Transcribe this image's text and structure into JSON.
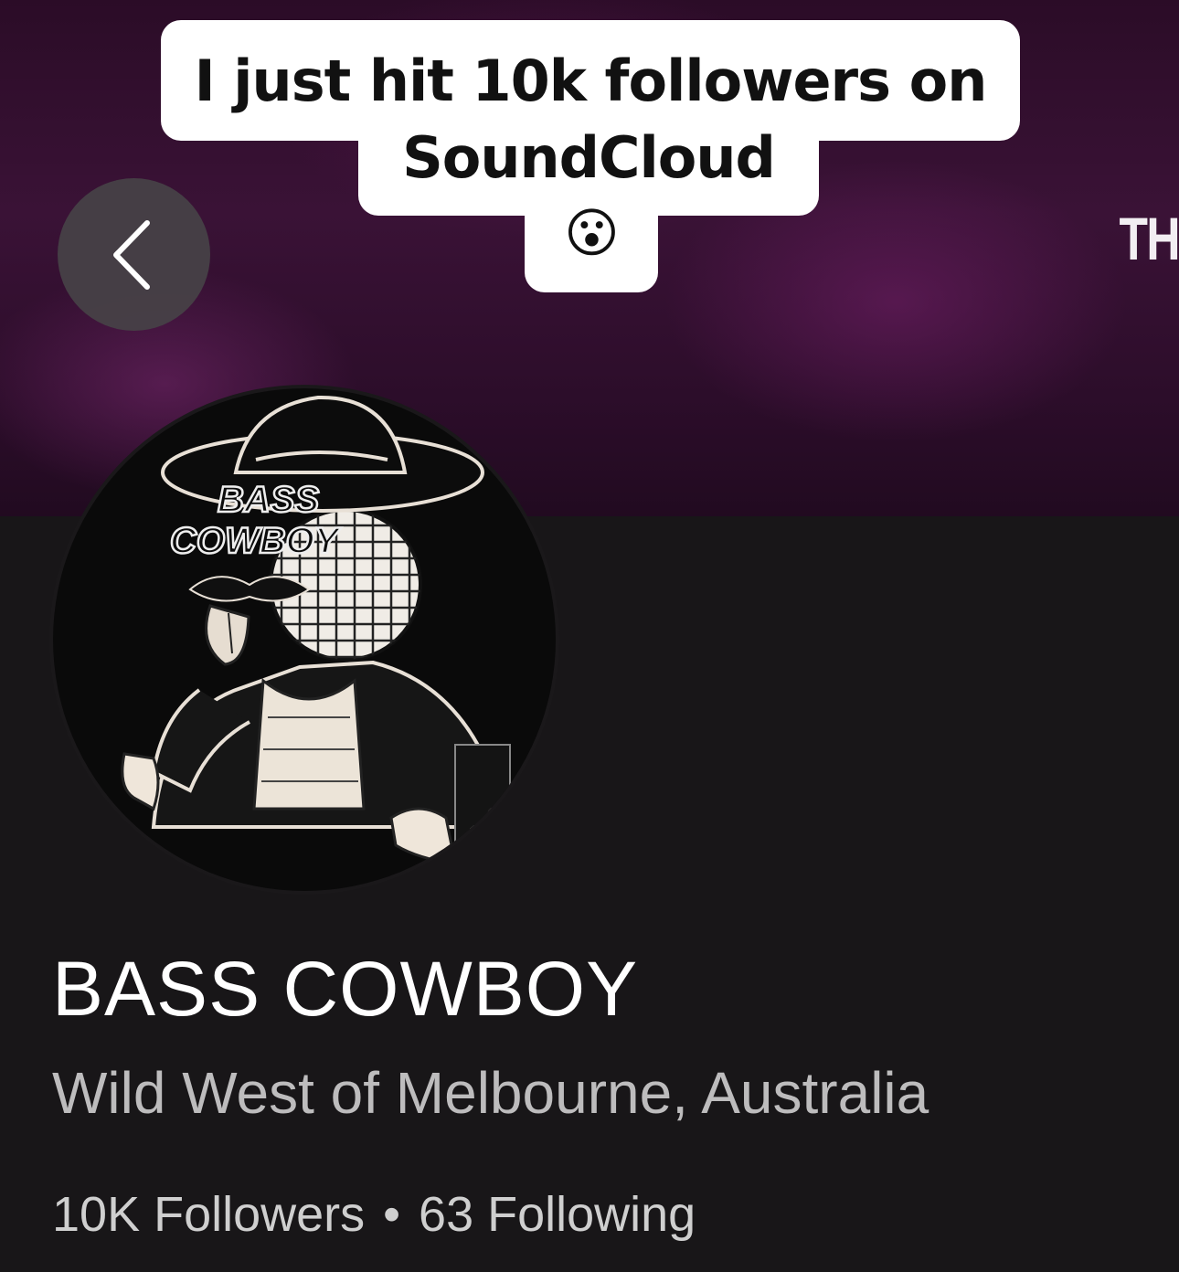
{
  "caption": {
    "line1": "I just hit 10k followers on",
    "line2": "SoundCloud",
    "emoji": "😮"
  },
  "banner": {
    "partial_text": "TH"
  },
  "back_button": {
    "icon": "chevron-left-icon"
  },
  "avatar": {
    "logo_text_line1": "BASS",
    "logo_text_line2": "COWBOY"
  },
  "profile": {
    "name": "BASS COWBOY",
    "location": "Wild West of Melbourne, Australia",
    "followers": "10K Followers",
    "separator": "•",
    "following": "63 Following"
  },
  "colors": {
    "banner": "#3a1236",
    "panel": "#181618",
    "name": "#ffffff",
    "location": "#bdbcbd",
    "back_button": "#464246"
  }
}
